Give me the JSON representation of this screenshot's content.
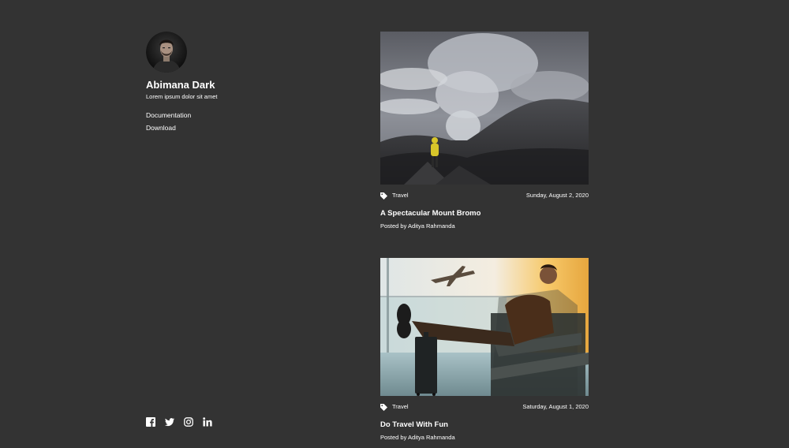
{
  "sidebar": {
    "avatar_alt": "avatar",
    "title": "Abimana Dark",
    "tagline": "Lorem ipsum dolor sit amet",
    "nav": [
      {
        "label": "Documentation"
      },
      {
        "label": "Download"
      }
    ],
    "social": [
      "facebook-icon",
      "twitter-icon",
      "instagram-icon",
      "linkedin-icon"
    ]
  },
  "posts": [
    {
      "tag": "Travel",
      "date": "Sunday, August 2, 2020",
      "title": "A Spectacular Mount Bromo",
      "author": "Posted by Aditya Rahmanda"
    },
    {
      "tag": "Travel",
      "date": "Saturday, August 1, 2020",
      "title": "Do Travel With Fun",
      "author": "Posted by Aditya Rahmanda"
    }
  ],
  "colors": {
    "background": "#333333",
    "text": "#ffffff"
  }
}
